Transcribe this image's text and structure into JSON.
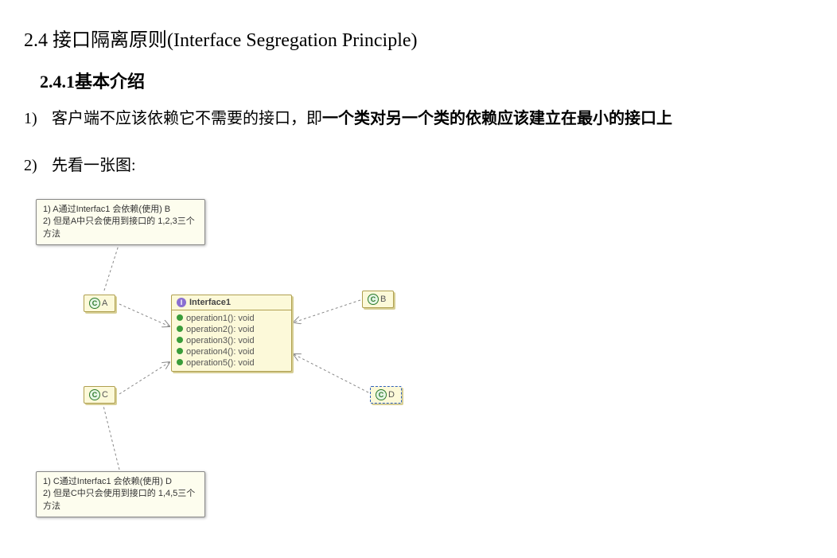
{
  "heading24": "2.4   接口隔离原则(Interface Segregation Principle)",
  "heading241": "2.4.1基本介绍",
  "item1_num": "1)",
  "item1_text1": "客户端不应该依赖它不需要的接口，即",
  "item1_text2": "一个类对另一个类的依赖应该建立在最小的接口上",
  "item2_num": "2)",
  "item2_text": "先看一张图:",
  "note_top_l1": "1) A通过Interfac1 会依赖(使用) B",
  "note_top_l2": "2) 但是A中只会使用到接口的 1,2,3三个方法",
  "note_bottom_l1": "1) C通过Interfac1 会依赖(使用) D",
  "note_bottom_l2": "2) 但是C中只会使用到接口的 1,4,5三个方法",
  "class_a": "A",
  "class_b": "B",
  "class_c": "C",
  "class_d": "D",
  "interface_title": "Interface1",
  "ops": {
    "o1": "operation1(): void",
    "o2": "operation2(): void",
    "o3": "operation3(): void",
    "o4": "operation4(): void",
    "o5": "operation5(): void"
  }
}
